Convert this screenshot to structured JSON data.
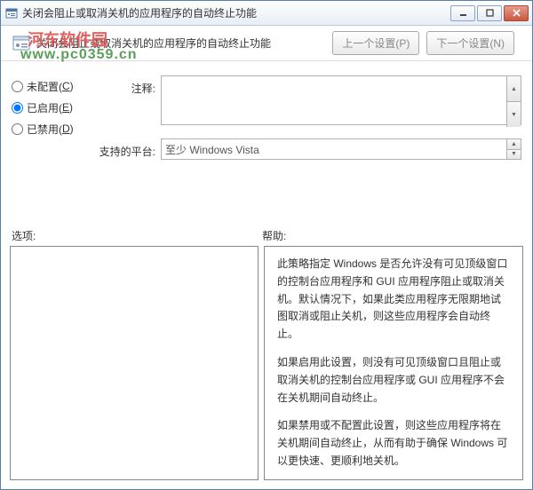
{
  "window": {
    "title": "关闭会阻止或取消关机的应用程序的自动终止功能"
  },
  "watermark": {
    "line1": "河东软件园",
    "line2": "www.pc0359.cn"
  },
  "header": {
    "subtitle": "关闭会阻止或取消关机的应用程序的自动终止功能",
    "prev_btn": "上一个设置(P)",
    "next_btn": "下一个设置(N)"
  },
  "radios": {
    "not_configured": "未配置(",
    "not_configured_key": "C",
    "enabled": "已启用(",
    "enabled_key": "E",
    "disabled": "已禁用(",
    "disabled_key": "D",
    "close_paren": ")"
  },
  "form": {
    "comment_label": "注释:",
    "platform_label": "支持的平台:",
    "platform_value": "至少 Windows Vista"
  },
  "columns": {
    "options": "选项:",
    "help": "帮助:"
  },
  "help": {
    "p1": "此策略指定 Windows 是否允许没有可见顶级窗口的控制台应用程序和 GUI 应用程序阻止或取消关机。默认情况下，如果此类应用程序无限期地试图取消或阻止关机，则这些应用程序会自动终止。",
    "p2": "如果启用此设置，则没有可见顶级窗口且阻止或取消关机的控制台应用程序或 GUI 应用程序不会在关机期间自动终止。",
    "p3": "如果禁用或不配置此设置，则这些应用程序将在关机期间自动终止，从而有助于确保 Windows 可以更快速、更顺利地关机。"
  }
}
